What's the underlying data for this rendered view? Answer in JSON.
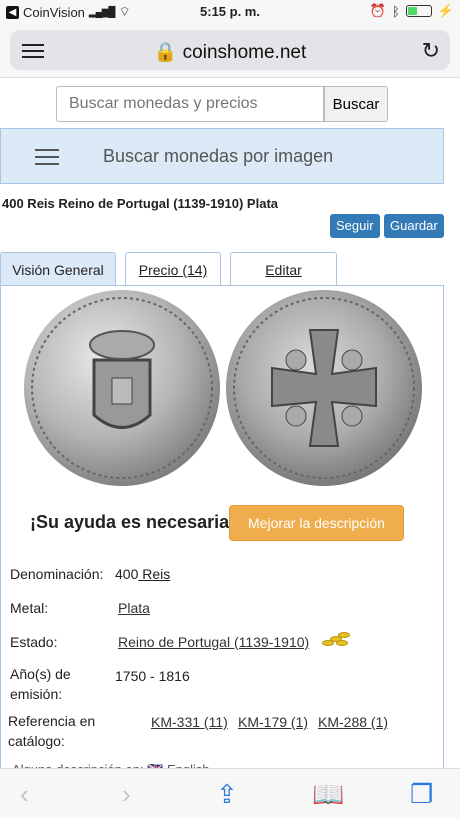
{
  "status_bar": {
    "back_label": "CoinVision",
    "time": "5:15 p. m."
  },
  "url_bar": {
    "url": "coinshome.net"
  },
  "search": {
    "placeholder": "Buscar monedas y precios",
    "button_label": "Buscar"
  },
  "image_search": {
    "label": "Buscar monedas por imagen"
  },
  "coin": {
    "title": "400 Reis Reino de Portugal (1139-1910) Plata",
    "follow_label": "Seguir",
    "save_label": "Guardar"
  },
  "tabs": [
    {
      "label": "Visión General"
    },
    {
      "label": "Precio (14)"
    },
    {
      "label": "Editar"
    }
  ],
  "help": {
    "text": "¡Su ayuda es necesaria!",
    "button_label": "Mejorar la descripción"
  },
  "details": {
    "denomination_label": "Denominación:",
    "denomination_value": "400",
    "denomination_unit": " Reis",
    "metal_label": "Metal:",
    "metal_value": "Plata",
    "state_label": "Estado:",
    "state_value": "Reino de Portugal (1139-1910)",
    "years_label_1": "Año(s) de",
    "years_label_2": "emisión:",
    "years_value": "1750 - 1816",
    "ref_label_1": "Referencia en",
    "ref_label_2": "catálogo:",
    "refs": [
      "KM-331 (11)",
      "KM-179 (1)",
      "KM-288 (1)"
    ]
  },
  "language_row": {
    "text": "Alguna descripción en:",
    "language": "English"
  }
}
